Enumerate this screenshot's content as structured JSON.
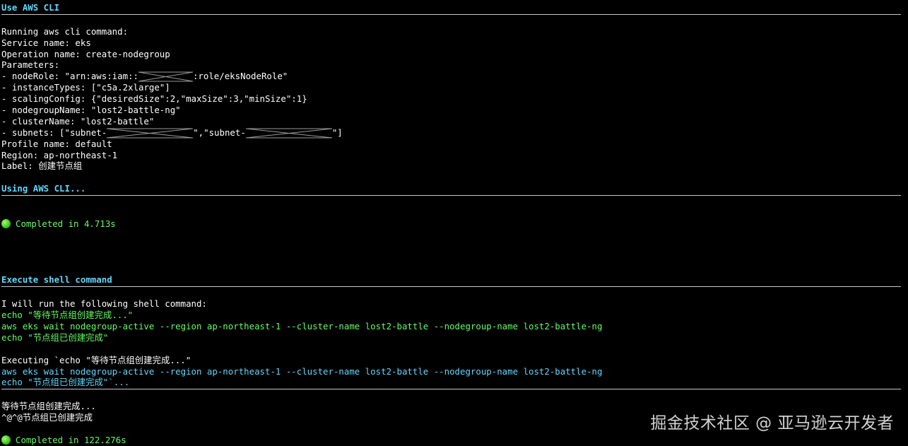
{
  "sections": {
    "aws_cli": {
      "heading": "Use AWS CLI",
      "running": "Running aws cli command:",
      "service": "Service name: eks",
      "operation": "Operation name: create-nodegroup",
      "parameters": "Parameters:",
      "node_role_prefix": "- nodeRole: \"arn:aws:iam::",
      "node_role_suffix": ":role/eksNodeRole\"",
      "instance_types": "- instanceTypes: [\"c5a.2xlarge\"]",
      "scaling_config": "- scalingConfig: {\"desiredSize\":2,\"maxSize\":3,\"minSize\":1}",
      "nodegroup_name": "- nodegroupName: \"lost2-battle-ng\"",
      "cluster_name": "- clusterName: \"lost2-battle\"",
      "subnets_prefix": "- subnets: [\"subnet-",
      "subnets_mid": "\",\"subnet-",
      "subnets_suffix": "\"]",
      "profile": "Profile name: default",
      "region": "Region: ap-northeast-1",
      "label": "Label: 创建节点组"
    },
    "using_cli": {
      "heading": "Using AWS CLI...",
      "completed": "Completed in 4.713s"
    },
    "shell": {
      "heading": "Execute shell command",
      "intro": "I will run the following shell command:",
      "cmd1": "echo \"等待节点组创建完成...\"",
      "cmd2": "aws eks wait nodegroup-active --region ap-northeast-1 --cluster-name lost2-battle --nodegroup-name lost2-battle-ng",
      "cmd3": "echo \"节点组已创建完成\"",
      "executing": "Executing `echo \"等待节点组创建完成...\"",
      "exec_cmd2": "aws eks wait nodegroup-active --region ap-northeast-1 --cluster-name lost2-battle --nodegroup-name lost2-battle-ng",
      "exec_cmd3": "echo \"节点组已创建完成\"`...",
      "output1": "等待节点组创建完成...",
      "output2": "^@^@节点组已创建完成",
      "completed": "Completed in 122.276s"
    }
  },
  "watermark": "掘金技术社区 @ 亚马逊云开发者",
  "colors": {
    "background": "#000000",
    "heading": "#5fd7ff",
    "command": "#5fff5f",
    "text": "#ffffff",
    "rule": "#c8c8c8"
  }
}
